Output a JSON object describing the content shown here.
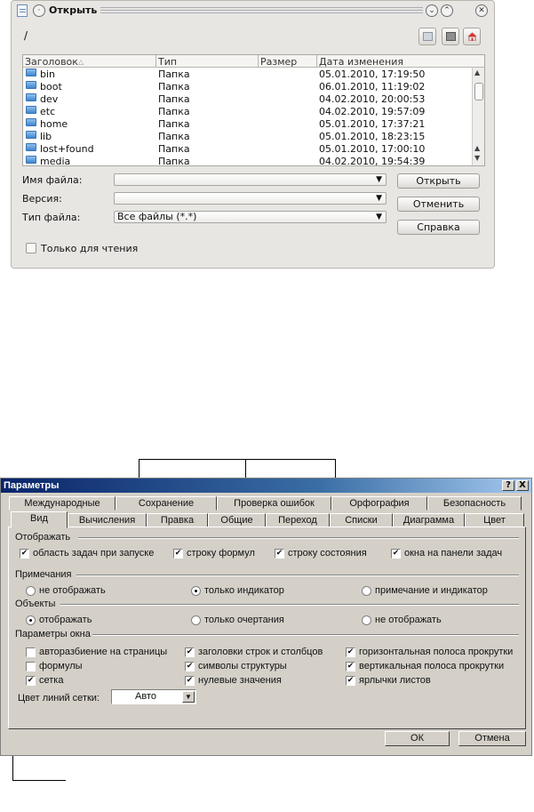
{
  "open_dialog": {
    "title": "Открыть",
    "path": "/",
    "columns": [
      "Заголовок",
      "Тип",
      "Размер",
      "Дата изменения"
    ],
    "files": [
      {
        "name": "bin",
        "type": "Папка",
        "date": "05.01.2010, 17:19:50"
      },
      {
        "name": "boot",
        "type": "Папка",
        "date": "06.01.2010, 11:19:02"
      },
      {
        "name": "dev",
        "type": "Папка",
        "date": "04.02.2010, 20:00:53"
      },
      {
        "name": "etc",
        "type": "Папка",
        "date": "04.02.2010, 19:57:09"
      },
      {
        "name": "home",
        "type": "Папка",
        "date": "05.01.2010, 17:37:21"
      },
      {
        "name": "lib",
        "type": "Папка",
        "date": "05.01.2010, 18:23:15"
      },
      {
        "name": "lost+found",
        "type": "Папка",
        "date": "05.01.2010, 17:00:10"
      },
      {
        "name": "media",
        "type": "Папка",
        "date": "04.02.2010, 19:54:39"
      }
    ],
    "filename_label": "Имя файла:",
    "filename_value": "",
    "version_label": "Версия:",
    "filetype_label": "Тип файла:",
    "filetype_value": "Все файлы (*.*)",
    "open_button": "Открыть",
    "cancel_button": "Отменить",
    "help_button": "Справка",
    "readonly_label": "Только для чтения"
  },
  "options_dialog": {
    "title": "Параметры",
    "help_btn": "?",
    "close_btn": "X",
    "tabs_row1": [
      "Международные",
      "Сохранение",
      "Проверка ошибок",
      "Орфография",
      "Безопасность"
    ],
    "tabs_row2": [
      "Вид",
      "Вычисления",
      "Правка",
      "Общие",
      "Переход",
      "Списки",
      "Диаграмма",
      "Цвет"
    ],
    "show_group": "Отображать",
    "show_items": [
      {
        "label": "область задач при запуске",
        "checked": true
      },
      {
        "label": "строку формул",
        "checked": true
      },
      {
        "label": "строку состояния",
        "checked": true
      },
      {
        "label": "окна на панели задач",
        "checked": true
      }
    ],
    "notes_group": "Примечания",
    "notes_options": [
      {
        "label": "не отображать",
        "selected": false
      },
      {
        "label": "только индикатор",
        "selected": true
      },
      {
        "label": "примечание и индикатор",
        "selected": false
      }
    ],
    "objects_group": "Объекты",
    "objects_options": [
      {
        "label": "отображать",
        "selected": true
      },
      {
        "label": "только очертания",
        "selected": false
      },
      {
        "label": "не отображать",
        "selected": false
      }
    ],
    "window_group": "Параметры окна",
    "window_items": [
      {
        "label": "авторазбиение на страницы",
        "checked": false
      },
      {
        "label": "формулы",
        "checked": false
      },
      {
        "label": "сетка",
        "checked": true
      },
      {
        "label": "заголовки строк и столбцов",
        "checked": true
      },
      {
        "label": "символы структуры",
        "checked": true
      },
      {
        "label": "нулевые значения",
        "checked": true
      },
      {
        "label": "горизонтальная полоса прокрутки",
        "checked": true
      },
      {
        "label": "вертикальная полоса прокрутки",
        "checked": true
      },
      {
        "label": "ярлычки листов",
        "checked": true
      }
    ],
    "gridcolor_label": "Цвет линий сетки:",
    "gridcolor_value": "Авто",
    "ok_button": "ОК",
    "cancel_button": "Отмена",
    "check_mark": "✔"
  }
}
